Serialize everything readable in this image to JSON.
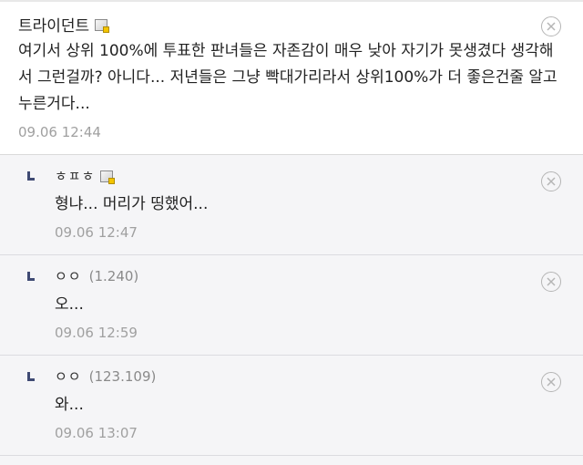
{
  "main_comment": {
    "nickname": "트라이던트",
    "text": "여기서 상위 100%에 투표한 판녀들은 자존감이 매우 낮아 자기가 못생겼다 생각해서 그런걸까? 아니다... 저년들은 그냥 빡대가리라서 상위100%가 더 좋은건줄 알고 누른거다...",
    "date": "09.06 12:44"
  },
  "replies": [
    {
      "nickname": "ㅎㅍㅎ",
      "ip": "",
      "text": "형냐... 머리가 띵했어...",
      "date": "09.06 12:47"
    },
    {
      "nickname": "ㅇㅇ",
      "ip": "(1.240)",
      "text": "오...",
      "date": "09.06 12:59"
    },
    {
      "nickname": "ㅇㅇ",
      "ip": "(123.109)",
      "text": "와...",
      "date": "09.06 13:07"
    }
  ],
  "icons": {
    "member": "member-badge-icon",
    "delete": "delete-circle-x-icon",
    "reply": "reply-arrow-icon"
  },
  "colors": {
    "reply_background": "#f5f5f7",
    "reply_arrow": "#3f4a73",
    "date_text": "#a0a0a0"
  }
}
